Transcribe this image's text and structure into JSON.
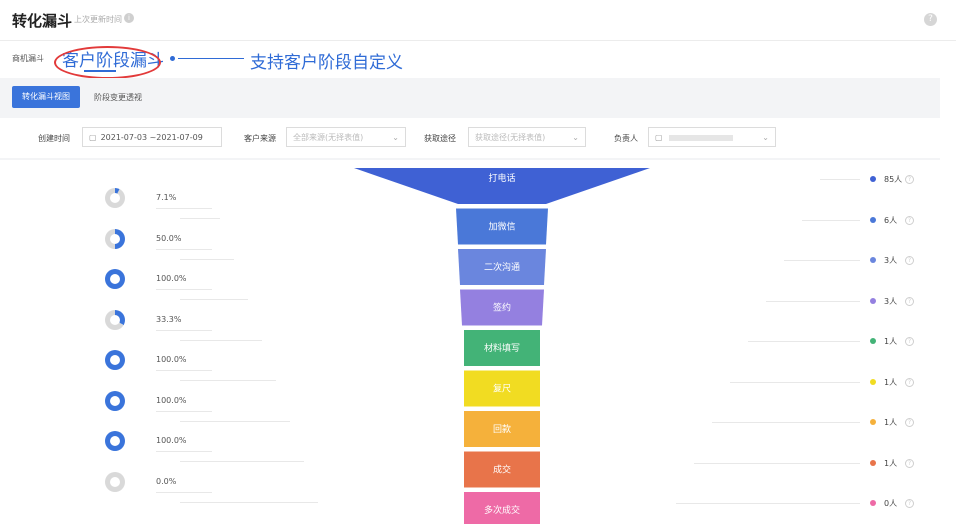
{
  "header": {
    "title": "转化漏斗",
    "last_update": "上次更新时间",
    "info_icon": "info-circle-icon",
    "help_icon": "help-circle-icon"
  },
  "tabs": {
    "opportunity": "商机漏斗",
    "customer_stage": "客户阶段漏斗"
  },
  "callout": {
    "text": "支持客户阶段自定义",
    "color": "#2f6bd6",
    "highlight_color": "#e23a3a"
  },
  "view": {
    "active_button": "转化漏斗视图",
    "secondary_link": "阶段变更透视"
  },
  "filters": {
    "created_label": "创建时间",
    "created_value": "2021-07-03 ~2021-07-09",
    "source_label": "客户来源",
    "source_placeholder": "全部来源(无择表值)",
    "channel_label": "获取途径",
    "channel_placeholder": "获取途径(无择表值)",
    "owner_label": "负责人",
    "owner_value": ""
  },
  "accent_color": "#3a74db",
  "stages": [
    {
      "name": "打电话",
      "count": "85人",
      "pct": "7.1%",
      "ratio": 0.071,
      "color": "#3f61d4"
    },
    {
      "name": "加微信",
      "count": "6人",
      "pct": "50.0%",
      "ratio": 0.5,
      "color": "#4a78d8"
    },
    {
      "name": "二次沟通",
      "count": "3人",
      "pct": "100.0%",
      "ratio": 1.0,
      "color": "#6a86de"
    },
    {
      "name": "签约",
      "count": "3人",
      "pct": "33.3%",
      "ratio": 0.333,
      "color": "#9480e0"
    },
    {
      "name": "材料填写",
      "count": "1人",
      "pct": "100.0%",
      "ratio": 1.0,
      "color": "#43b377"
    },
    {
      "name": "复尺",
      "count": "1人",
      "pct": "100.0%",
      "ratio": 1.0,
      "color": "#f1dc22"
    },
    {
      "name": "回款",
      "count": "1人",
      "pct": "100.0%",
      "ratio": 1.0,
      "color": "#f5b13b"
    },
    {
      "name": "成交",
      "count": "1人",
      "pct": "0.0%",
      "ratio": 0.0,
      "color": "#e8744a"
    },
    {
      "name": "多次成交",
      "count": "0人",
      "pct": "",
      "ratio": null,
      "color": "#ee6aa6"
    }
  ]
}
